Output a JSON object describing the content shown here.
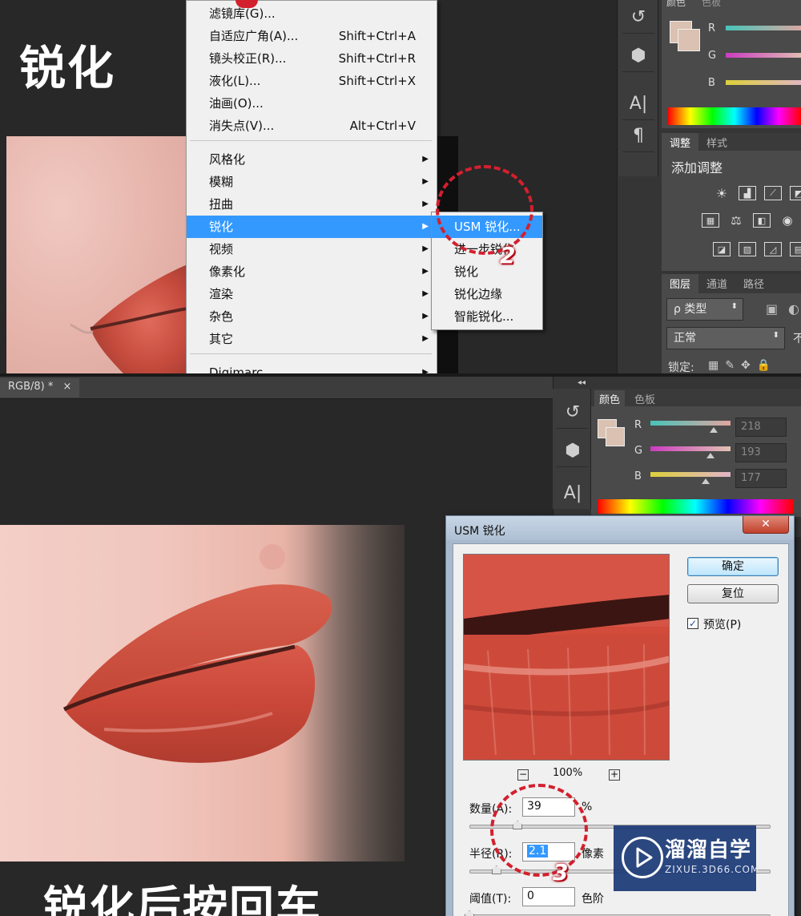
{
  "top": {
    "title": "锐化",
    "filter_menu": {
      "items": [
        {
          "label": "滤镜库(G)...",
          "shortcut": "",
          "submenu": false
        },
        {
          "label": "自适应广角(A)...",
          "shortcut": "Shift+Ctrl+A",
          "submenu": false
        },
        {
          "label": "镜头校正(R)...",
          "shortcut": "Shift+Ctrl+R",
          "submenu": false
        },
        {
          "label": "液化(L)...",
          "shortcut": "Shift+Ctrl+X",
          "submenu": false
        },
        {
          "label": "油画(O)...",
          "shortcut": "",
          "submenu": false
        },
        {
          "label": "消失点(V)...",
          "shortcut": "Alt+Ctrl+V",
          "submenu": false
        },
        {
          "label": "风格化",
          "shortcut": "",
          "submenu": true
        },
        {
          "label": "模糊",
          "shortcut": "",
          "submenu": true
        },
        {
          "label": "扭曲",
          "shortcut": "",
          "submenu": true
        },
        {
          "label": "锐化",
          "shortcut": "",
          "submenu": true,
          "highlighted": true
        },
        {
          "label": "视频",
          "shortcut": "",
          "submenu": true
        },
        {
          "label": "像素化",
          "shortcut": "",
          "submenu": true
        },
        {
          "label": "渲染",
          "shortcut": "",
          "submenu": true
        },
        {
          "label": "杂色",
          "shortcut": "",
          "submenu": true
        },
        {
          "label": "其它",
          "shortcut": "",
          "submenu": true
        },
        {
          "label": "Digimarc",
          "shortcut": "",
          "submenu": true
        }
      ]
    },
    "sharpen_submenu": {
      "items": [
        {
          "label": "USM 锐化...",
          "highlighted": true
        },
        {
          "label": "进一步锐化"
        },
        {
          "label": "锐化"
        },
        {
          "label": "锐化边缘"
        },
        {
          "label": "智能锐化..."
        }
      ]
    },
    "annotation_number": "2",
    "color_panel": {
      "tabs": [
        "颜色",
        "色板"
      ],
      "channels": [
        "R",
        "G",
        "B"
      ]
    },
    "adjust_panel": {
      "tabs": [
        "调整",
        "样式"
      ],
      "heading": "添加调整"
    },
    "layers_panel": {
      "tabs": [
        "图层",
        "通道",
        "路径"
      ],
      "kind_filter": "ρ 类型",
      "blend_mode": "正常",
      "lock_label": "锁定:",
      "opacity_label_partial": "不"
    }
  },
  "bottom": {
    "doc_tab": "RGB/8) *",
    "doc_tab_close": "×",
    "color_panel": {
      "tabs": [
        "颜色",
        "色板"
      ],
      "channels": [
        {
          "name": "R",
          "value": "218"
        },
        {
          "name": "G",
          "value": "193"
        },
        {
          "name": "B",
          "value": "177"
        }
      ]
    },
    "usm_dialog": {
      "title": "USM 锐化",
      "close": "✕",
      "ok_label": "确定",
      "reset_label": "复位",
      "preview_label": "预览(P)",
      "preview_checked": true,
      "zoom_minus": "−",
      "zoom_plus": "+",
      "zoom_level": "100%",
      "amount_label": "数量(A):",
      "amount_value": "39",
      "amount_unit": "%",
      "radius_label": "半径(R):",
      "radius_value": "2.1",
      "radius_unit": "像素",
      "threshold_label": "阈值(T):",
      "threshold_value": "0",
      "threshold_unit": "色阶",
      "amount_level": 0.16,
      "radius_level": 0.09,
      "threshold_level": 0.0
    },
    "annotation_number": "3",
    "caption": "锐化后按回车"
  },
  "watermark": {
    "name": "溜溜自学",
    "url": "ZIXUE.3D66.COM"
  },
  "colors": {
    "menu_highlight": "#3399ff",
    "annotation_red": "#d3202e",
    "swatch": "#dac1b1",
    "watermark_bg": "#1d3b78"
  }
}
